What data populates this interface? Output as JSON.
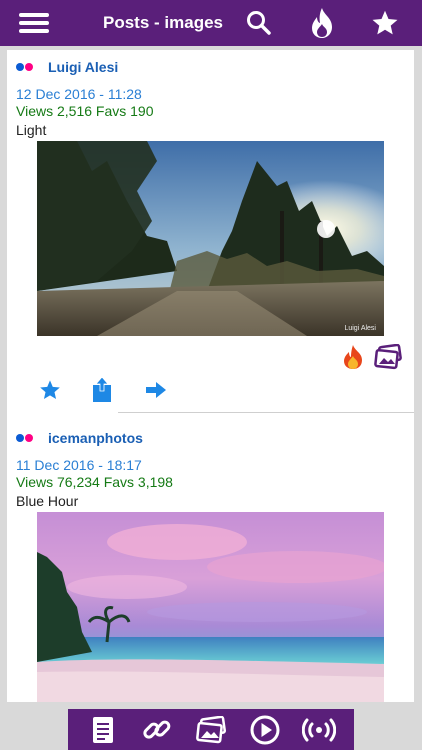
{
  "header": {
    "title": "Posts - images",
    "menu_icon": "hamburger-menu-icon",
    "search_icon": "search-icon",
    "hot_icon": "flame-icon",
    "favorites_icon": "star-icon"
  },
  "posts": [
    {
      "author": "Luigi Alesi",
      "date": "12 Dec 2016 - 11:28",
      "stats": "Views 2,516  Favs 190",
      "caption": "Light",
      "photo_credit": "Luigi Alesi"
    },
    {
      "author": "icemanphotos",
      "date": "11 Dec 2016 - 18:17",
      "stats": "Views 76,234  Favs 3,198",
      "caption": "Blue Hour"
    }
  ],
  "bottom_bar": {
    "items": [
      "document-icon",
      "link-icon",
      "images-icon",
      "play-icon",
      "broadcast-icon"
    ]
  },
  "colors": {
    "bar": "#5a1f7a",
    "author": "#1a5fb4",
    "date": "#2a7fd4",
    "stats": "#157a15",
    "action": "#1e88e5"
  }
}
